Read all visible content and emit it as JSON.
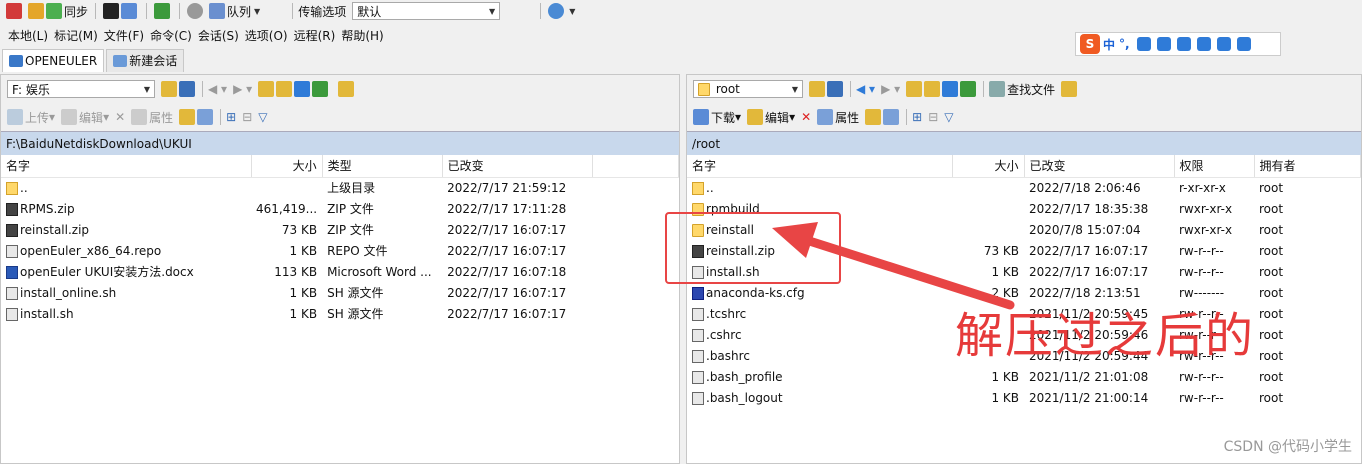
{
  "toolbar": {
    "sync_label": "同步",
    "queue_label": "队列",
    "transfer_label": "传输选项",
    "transfer_value": "默认"
  },
  "menu": [
    "本地(L)",
    "标记(M)",
    "文件(F)",
    "命令(C)",
    "会话(S)",
    "选项(O)",
    "远程(R)",
    "帮助(H)"
  ],
  "tabs": [
    {
      "label": "OPENEULER",
      "active": true
    },
    {
      "label": "新建会话",
      "active": false
    }
  ],
  "ime": {
    "brand": "S",
    "lang": "中",
    "punct": "°,"
  },
  "left": {
    "drive": "F: 娱乐",
    "actions": [
      "上传",
      "编辑",
      "属性"
    ],
    "path": "F:\\BaiduNetdiskDownload\\UKUI",
    "columns": [
      "名字",
      "大小",
      "类型",
      "已改变"
    ],
    "rows": [
      {
        "icon": "up",
        "name": "..",
        "size": "",
        "type": "上级目录",
        "modified": "2022/7/17  21:59:12"
      },
      {
        "icon": "zip",
        "name": "RPMS.zip",
        "size": "461,419...",
        "type": "ZIP 文件",
        "modified": "2022/7/17  17:11:28"
      },
      {
        "icon": "zip",
        "name": "reinstall.zip",
        "size": "73 KB",
        "type": "ZIP 文件",
        "modified": "2022/7/17  16:07:17"
      },
      {
        "icon": "sh",
        "name": "openEuler_x86_64.repo",
        "size": "1 KB",
        "type": "REPO 文件",
        "modified": "2022/7/17  16:07:17"
      },
      {
        "icon": "doc",
        "name": "openEuler UKUI安装方法.docx",
        "size": "113 KB",
        "type": "Microsoft Word ...",
        "modified": "2022/7/17  16:07:18"
      },
      {
        "icon": "sh",
        "name": "install_online.sh",
        "size": "1 KB",
        "type": "SH 源文件",
        "modified": "2022/7/17  16:07:17"
      },
      {
        "icon": "sh",
        "name": "install.sh",
        "size": "1 KB",
        "type": "SH 源文件",
        "modified": "2022/7/17  16:07:17"
      }
    ]
  },
  "right": {
    "folder": "root",
    "find_label": "查找文件",
    "actions": [
      "下载",
      "编辑",
      "属性"
    ],
    "path": "/root",
    "columns": [
      "名字",
      "大小",
      "已改变",
      "权限",
      "拥有者"
    ],
    "rows": [
      {
        "icon": "up",
        "name": "..",
        "size": "",
        "modified": "2022/7/18 2:06:46",
        "perm": "r-xr-xr-x",
        "owner": "root"
      },
      {
        "icon": "folder",
        "name": "rpmbuild",
        "size": "",
        "modified": "2022/7/17 18:35:38",
        "perm": "rwxr-xr-x",
        "owner": "root"
      },
      {
        "icon": "folder",
        "name": "reinstall",
        "size": "",
        "modified": "2020/7/8 15:07:04",
        "perm": "rwxr-xr-x",
        "owner": "root"
      },
      {
        "icon": "zip",
        "name": "reinstall.zip",
        "size": "73 KB",
        "modified": "2022/7/17 16:07:17",
        "perm": "rw-r--r--",
        "owner": "root"
      },
      {
        "icon": "sh",
        "name": "install.sh",
        "size": "1 KB",
        "modified": "2022/7/17 16:07:17",
        "perm": "rw-r--r--",
        "owner": "root"
      },
      {
        "icon": "cfg",
        "name": "anaconda-ks.cfg",
        "size": "2 KB",
        "modified": "2022/7/18 2:13:51",
        "perm": "rw-------",
        "owner": "root"
      },
      {
        "icon": "sh",
        "name": ".tcshrc",
        "size": "",
        "modified": "2021/11/2 20:59:45",
        "perm": "rw-r--r--",
        "owner": "root"
      },
      {
        "icon": "sh",
        "name": ".cshrc",
        "size": "",
        "modified": "2021/11/2 20:59:46",
        "perm": "rw-r--r--",
        "owner": "root"
      },
      {
        "icon": "sh",
        "name": ".bashrc",
        "size": "",
        "modified": "2021/11/2 20:59:44",
        "perm": "rw-r--r--",
        "owner": "root"
      },
      {
        "icon": "sh",
        "name": ".bash_profile",
        "size": "1 KB",
        "modified": "2021/11/2 21:01:08",
        "perm": "rw-r--r--",
        "owner": "root"
      },
      {
        "icon": "sh",
        "name": ".bash_logout",
        "size": "1 KB",
        "modified": "2021/11/2 21:00:14",
        "perm": "rw-r--r--",
        "owner": "root"
      }
    ]
  },
  "annotation": "解压过之后的",
  "watermark": "CSDN @代码小学生",
  "colors": {
    "accent_red": "#e63a3a",
    "path_bar": "#c8d8ec"
  }
}
